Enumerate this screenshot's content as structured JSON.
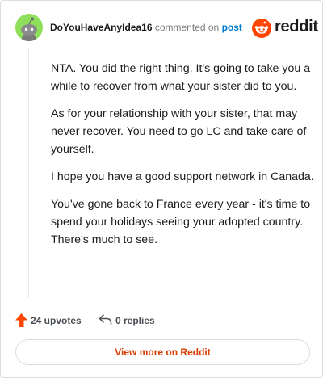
{
  "header": {
    "username": "DoYouHaveAnyIdea16",
    "commented_text": "commented on",
    "post_link": "post",
    "brand": "reddit"
  },
  "comment": {
    "paragraphs": [
      "NTA. You did the right thing. It's going to take you a while to recover from what your sister did to you.",
      "As for your relationship with your sister, that may never recover. You need to go LC and take care of yourself.",
      "I hope you have a good support network in Canada.",
      "You've gone back to France every year - it's time to spend your holidays seeing your adopted country. There's much to see."
    ]
  },
  "actions": {
    "upvotes_label": "24 upvotes",
    "replies_label": "0 replies"
  },
  "view_more_label": "View more on Reddit",
  "colors": {
    "accent": "#d93a00",
    "upvote": "#ff4500",
    "link": "#0079d3",
    "avatar_bg": "#8ee05a"
  },
  "icons": {
    "upvote": "upvote-arrow-icon",
    "reply": "reply-arrow-icon",
    "brand": "reddit-snoo-icon"
  }
}
